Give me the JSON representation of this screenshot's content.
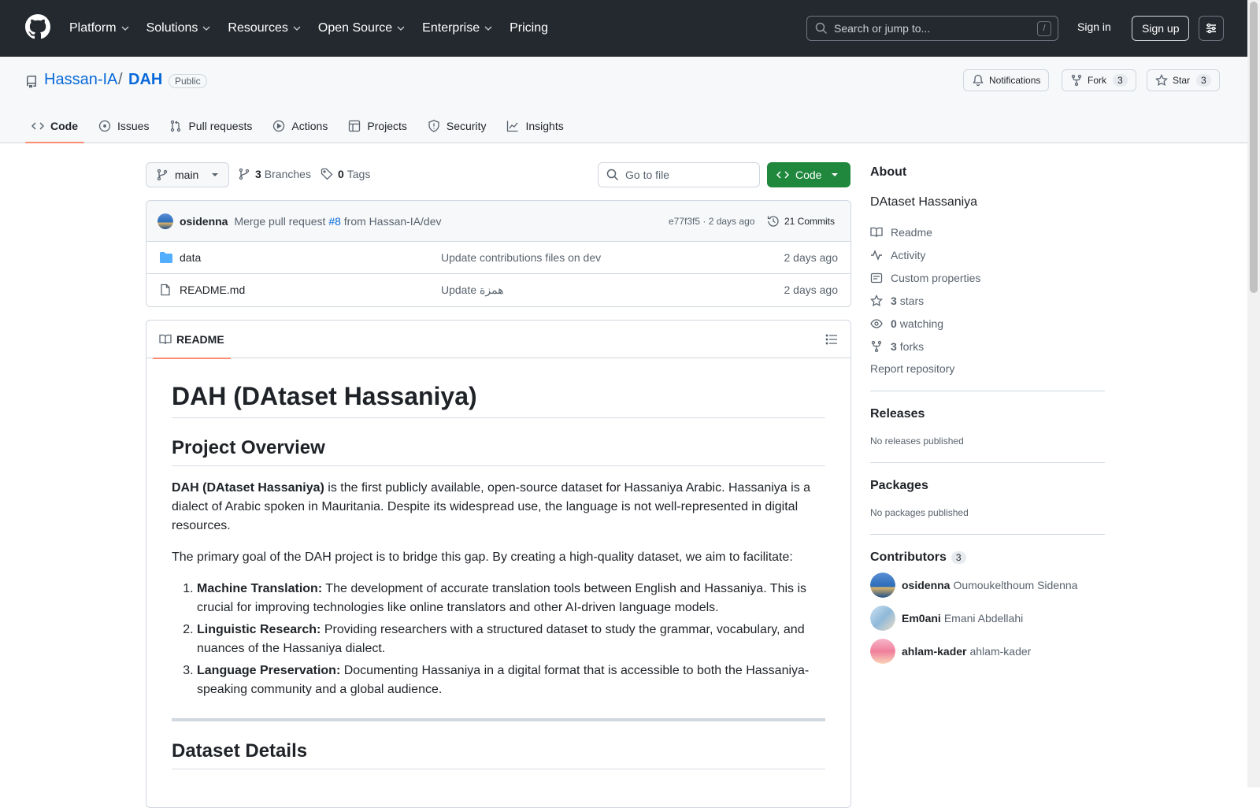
{
  "topbar": {
    "nav": [
      "Platform",
      "Solutions",
      "Resources",
      "Open Source",
      "Enterprise",
      "Pricing"
    ],
    "search_placeholder": "Search or jump to...",
    "search_shortcut": "/",
    "signin": "Sign in",
    "signup": "Sign up"
  },
  "repo": {
    "owner": "Hassan-IA",
    "separator": "/",
    "name": "DAH",
    "visibility": "Public",
    "notifications": "Notifications",
    "fork_label": "Fork",
    "fork_count": "3",
    "star_label": "Star",
    "star_count": "3"
  },
  "tabs": [
    "Code",
    "Issues",
    "Pull requests",
    "Actions",
    "Projects",
    "Security",
    "Insights"
  ],
  "toolbar": {
    "branch": "main",
    "branches_count": "3",
    "branches_label": "Branches",
    "tags_count": "0",
    "tags_label": "Tags",
    "goto_placeholder": "Go to file",
    "code_label": "Code"
  },
  "commit": {
    "author": "osidenna",
    "msg_prefix": "Merge pull request",
    "pr": "#8",
    "msg_suffix": "from Hassan-IA/dev",
    "sha": "e77f3f5 · 2 days ago",
    "commits": "21 Commits"
  },
  "files": [
    {
      "name": "data",
      "message": "Update contributions files on dev",
      "date": "2 days ago"
    },
    {
      "name": "README.md",
      "message": "Update همزة",
      "date": "2 days ago"
    }
  ],
  "readme": {
    "tab": "README",
    "h1": "DAH (DAtaset Hassaniya)",
    "h2_overview": "Project Overview",
    "p1_bold": "DAH (DAtaset Hassaniya)",
    "p1_rest": " is the first publicly available, open-source dataset for Hassaniya Arabic. Hassaniya is a dialect of Arabic spoken in Mauritania. Despite its widespread use, the language is not well-represented in digital resources.",
    "p2": "The primary goal of the DAH project is to bridge this gap. By creating a high-quality dataset, we aim to facilitate:",
    "list": [
      {
        "bold": "Machine Translation:",
        "text": " The development of accurate translation tools between English and Hassaniya. This is crucial for improving technologies like online translators and other AI-driven language models."
      },
      {
        "bold": "Linguistic Research:",
        "text": " Providing researchers with a structured dataset to study the grammar, vocabulary, and nuances of the Hassaniya dialect."
      },
      {
        "bold": "Language Preservation:",
        "text": " Documenting Hassaniya in a digital format that is accessible to both the Hassaniya-speaking community and a global audience."
      }
    ],
    "h2_details": "Dataset Details"
  },
  "sidebar": {
    "about": "About",
    "description": "DAtaset Hassaniya",
    "readme": "Readme",
    "activity": "Activity",
    "custom_properties": "Custom properties",
    "stars_count": "3",
    "stars_label": "stars",
    "watching_count": "0",
    "watching_label": "watching",
    "forks_count": "3",
    "forks_label": "forks",
    "report": "Report repository",
    "releases": "Releases",
    "no_releases": "No releases published",
    "packages": "Packages",
    "no_packages": "No packages published",
    "contributors": "Contributors",
    "contributors_count": "3",
    "contributor_list": [
      {
        "login": "osidenna",
        "name": "Oumoukelthoum Sidenna"
      },
      {
        "login": "Em0ani",
        "name": "Emani Abdellahi"
      },
      {
        "login": "ahlam-kader",
        "name": "ahlam-kader"
      }
    ]
  },
  "colors": {
    "header_bg": "#24292f",
    "link": "#0969da",
    "primary_button": "#1f883d",
    "tab_underline": "#fd8c73"
  }
}
